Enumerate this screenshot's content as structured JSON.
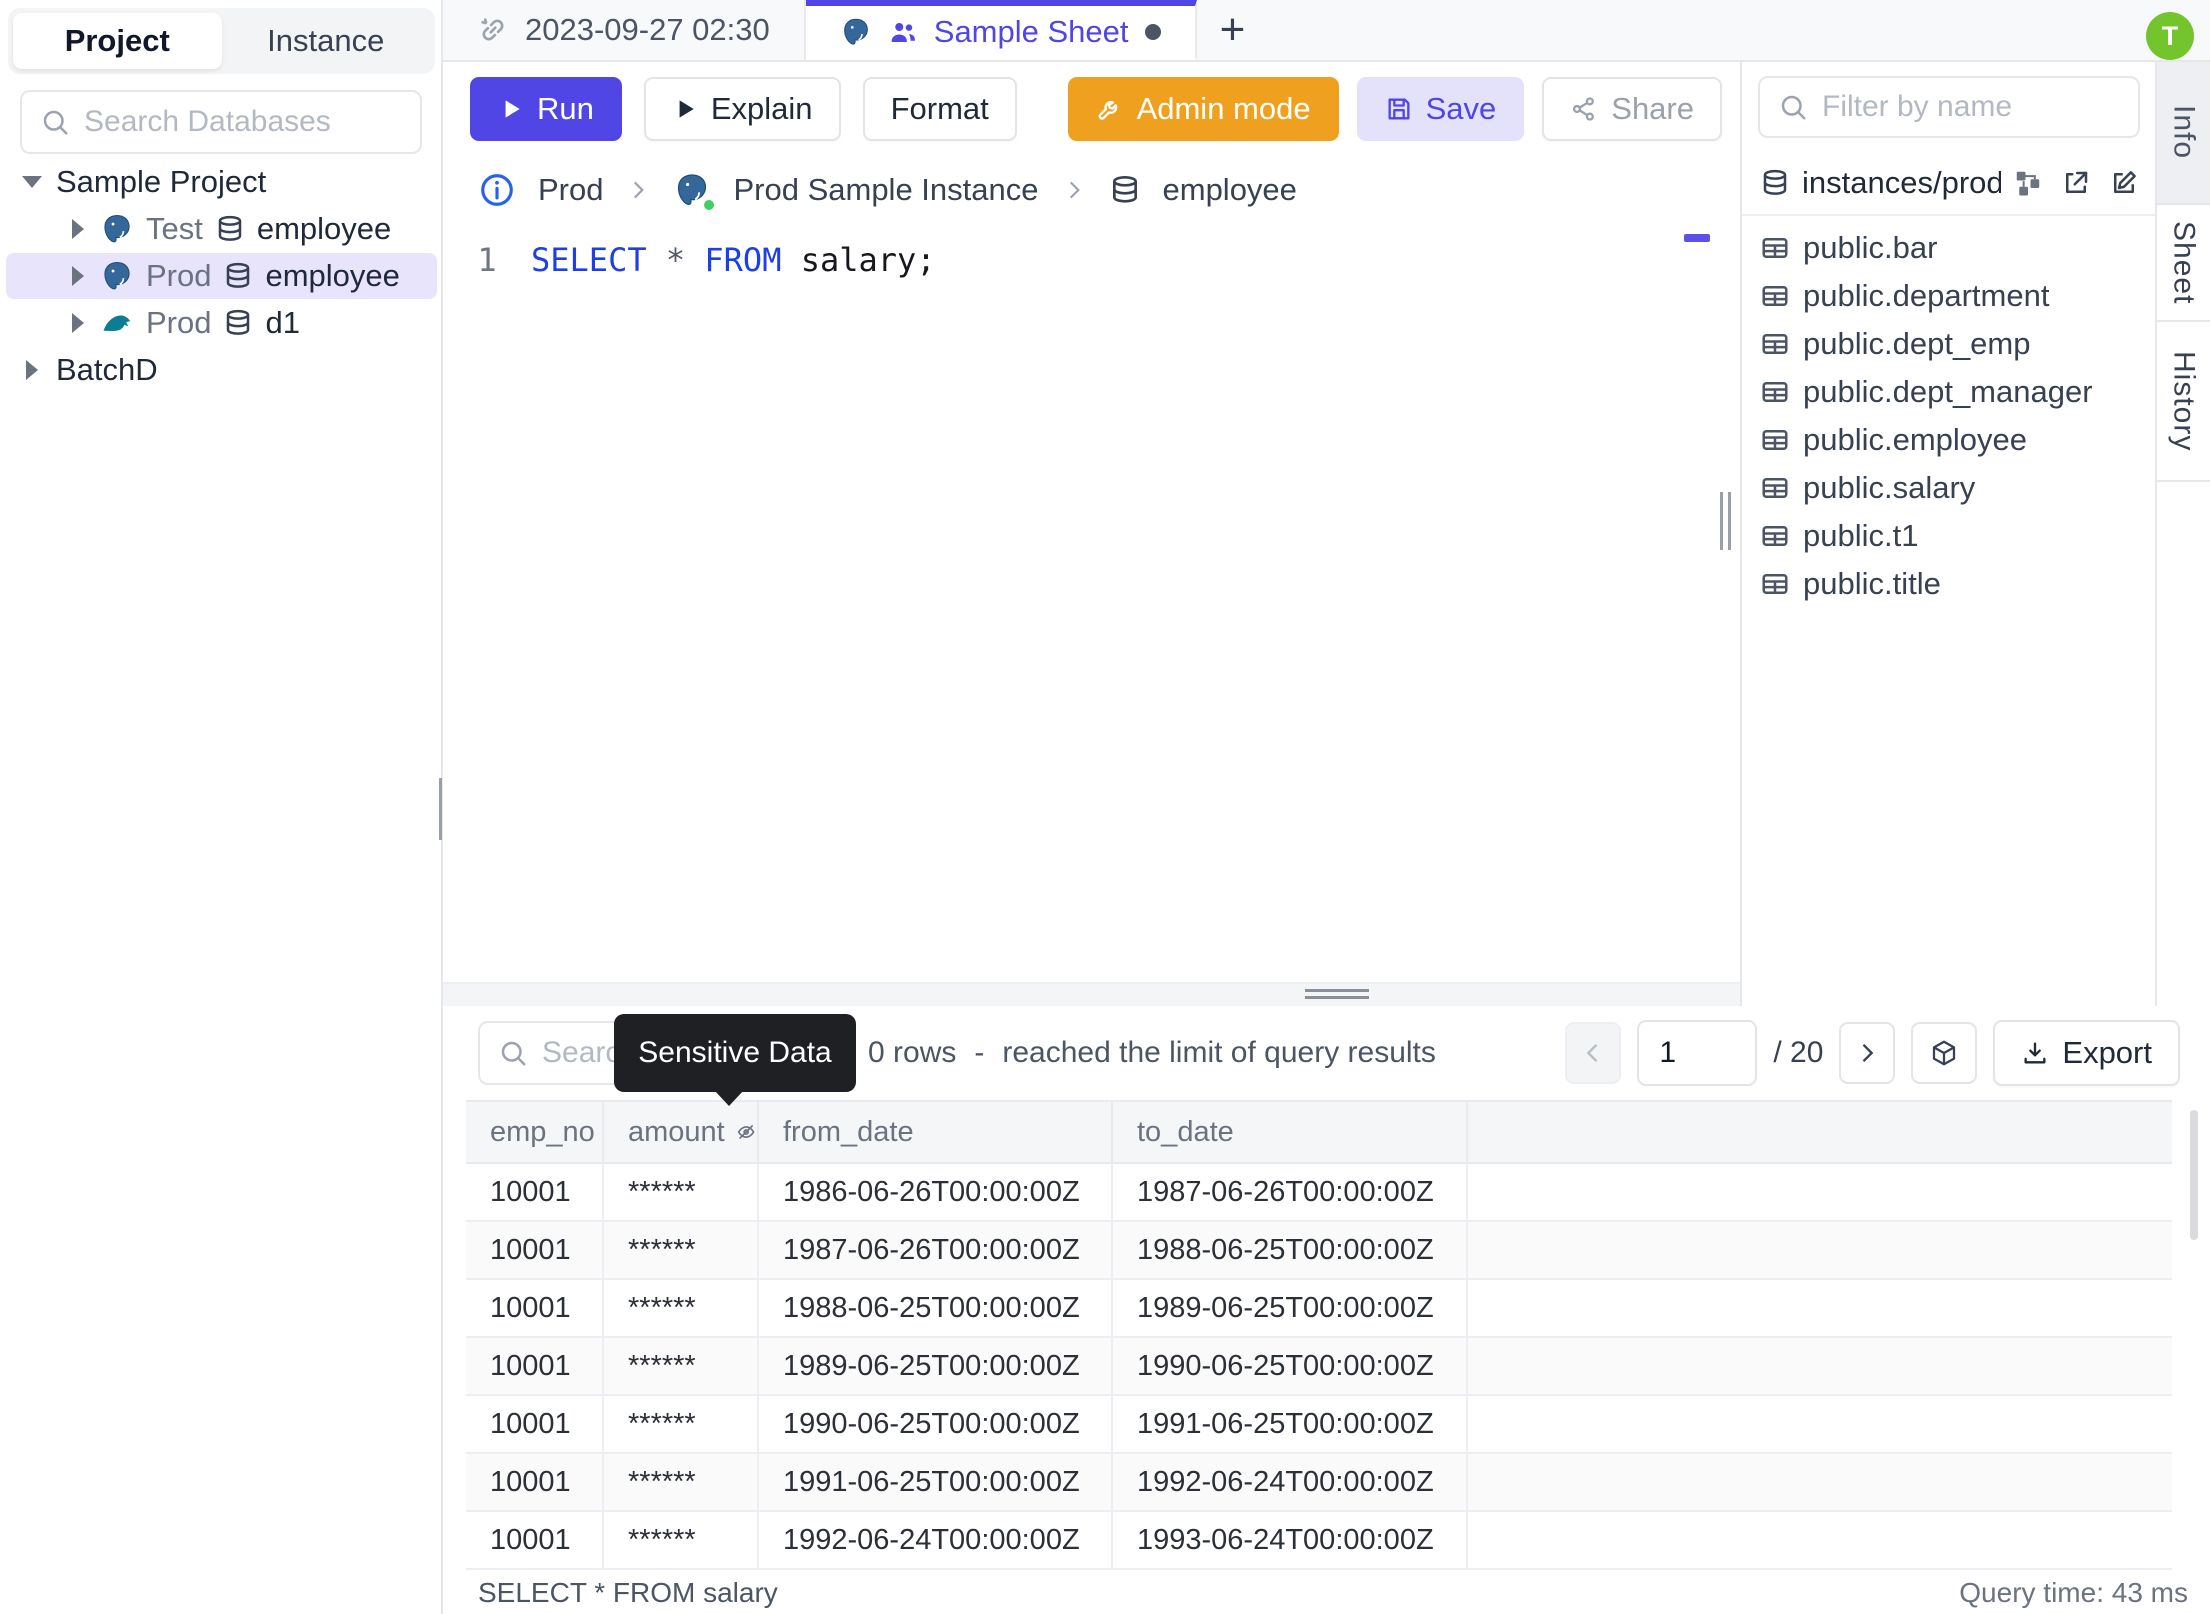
{
  "colors": {
    "accent_indigo": "#4f46e5",
    "admin_orange": "#f0a01f",
    "avatar_green": "#74c42d",
    "instance_online_green": "#41cf63",
    "tooltip_bg": "#1f2024",
    "sql_keyword_blue": "#1d3fe3",
    "selected_tree_bg": "#e7e4fb"
  },
  "icons": {
    "search": "magnifier",
    "unlink": "broken-chain-link",
    "postgresql": "blue-elephant",
    "mysql": "teal-dolphin",
    "database": "cylinder-stack",
    "table": "grid-card",
    "eye_off": "masked-column",
    "cube": "3d-box",
    "download": "arrow-into-tray"
  },
  "leftSidebar": {
    "tabs": [
      {
        "label": "Project"
      },
      {
        "label": "Instance"
      }
    ],
    "search_placeholder": "Search Databases",
    "tree": {
      "project_label": "Sample Project",
      "rows": [
        {
          "engine": "postgresql",
          "env": "Test",
          "db": "employee"
        },
        {
          "engine": "postgresql",
          "env": "Prod",
          "db": "employee"
        },
        {
          "engine": "mysql",
          "env": "Prod",
          "db": "d1"
        }
      ],
      "collapsed_label": "BatchD"
    }
  },
  "tabBar": {
    "history_tab": "2023-09-27 02:30",
    "active_tab": "Sample Sheet",
    "new_tab": "+",
    "avatar_initial": "T"
  },
  "toolbar": {
    "run": "Run",
    "explain": "Explain",
    "format": "Format",
    "admin_mode": "Admin mode",
    "save": "Save",
    "share": "Share"
  },
  "breadcrumb": {
    "environment": "Prod",
    "instance": "Prod Sample Instance",
    "database": "employee"
  },
  "editor": {
    "line_number": "1",
    "sql_select": "SELECT",
    "sql_star": " * ",
    "sql_from": "FROM",
    "sql_rest": " salary;"
  },
  "rightPanel": {
    "filter_placeholder": "Filter by name",
    "connection": "instances/prod",
    "tables": [
      "public.bar",
      "public.department",
      "public.dept_emp",
      "public.dept_manager",
      "public.employee",
      "public.salary",
      "public.t1",
      "public.title"
    ],
    "side_tabs": [
      "Info",
      "Sheet",
      "History"
    ]
  },
  "results": {
    "search_placeholder": "Search",
    "tooltip": "Sensitive Data",
    "row_count": "0 rows",
    "separator": "-",
    "limit_message": "reached the limit of query results",
    "pager": {
      "page": "1",
      "total": "/ 20"
    },
    "export_label": "Export",
    "columns": [
      "emp_no",
      "amount",
      "from_date",
      "to_date"
    ],
    "rows": [
      [
        "10001",
        "******",
        "1986-06-26T00:00:00Z",
        "1987-06-26T00:00:00Z"
      ],
      [
        "10001",
        "******",
        "1987-06-26T00:00:00Z",
        "1988-06-25T00:00:00Z"
      ],
      [
        "10001",
        "******",
        "1988-06-25T00:00:00Z",
        "1989-06-25T00:00:00Z"
      ],
      [
        "10001",
        "******",
        "1989-06-25T00:00:00Z",
        "1990-06-25T00:00:00Z"
      ],
      [
        "10001",
        "******",
        "1990-06-25T00:00:00Z",
        "1991-06-25T00:00:00Z"
      ],
      [
        "10001",
        "******",
        "1991-06-25T00:00:00Z",
        "1992-06-24T00:00:00Z"
      ],
      [
        "10001",
        "******",
        "1992-06-24T00:00:00Z",
        "1993-06-24T00:00:00Z"
      ]
    ]
  },
  "statusBar": {
    "query": "SELECT * FROM salary",
    "query_time": "Query time: 43 ms"
  }
}
